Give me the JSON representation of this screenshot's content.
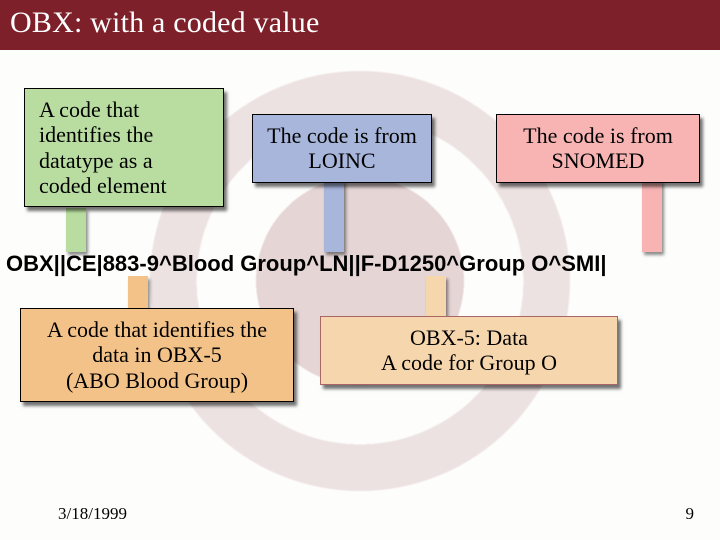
{
  "title": "OBX: with a coded value",
  "callouts": {
    "datatype": "A code that identifies the datatype as a coded element",
    "loinc": "The code is from LOINC",
    "snomed": "The code is from SNOMED",
    "obx5_id": "A code that identifies the data in OBX-5\n(ABO Blood Group)",
    "obx5_data": "OBX-5: Data\nA code for Group O"
  },
  "codeline": "OBX||CE|883-9^Blood Group^LN||F-D1250^Group O^SMI|",
  "footer": {
    "date": "3/18/1999",
    "page": "9"
  },
  "colors": {
    "titlebar": "#7d202a",
    "green": "#b9dda0",
    "blue": "#a8b6dc",
    "pink": "#f8b3b3",
    "orange": "#f3c289",
    "peach": "#f6d6ad"
  }
}
